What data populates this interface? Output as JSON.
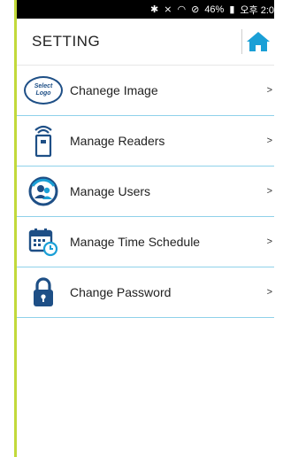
{
  "statusbar": {
    "battery": "46%",
    "time": "오후 2:0",
    "icons": [
      "bluetooth-icon",
      "mute-icon",
      "wifi-icon",
      "do-not-disturb-icon",
      "battery-icon"
    ]
  },
  "header": {
    "title": "SETTING",
    "home_icon": "home-icon"
  },
  "logo_text": {
    "line1": "Select",
    "line2": "Logo"
  },
  "items": [
    {
      "label": "Chanege Image",
      "chevron": ">"
    },
    {
      "label": "Manage Readers",
      "chevron": ">"
    },
    {
      "label": "Manage Users",
      "chevron": ">"
    },
    {
      "label": "Manage Time Schedule",
      "chevron": ">"
    },
    {
      "label": "Change Password",
      "chevron": ">"
    }
  ],
  "colors": {
    "accent": "#1e4f86",
    "divider": "#8fd1ea",
    "home": "#1a9fd6",
    "left_bar": "#c2d93a"
  }
}
